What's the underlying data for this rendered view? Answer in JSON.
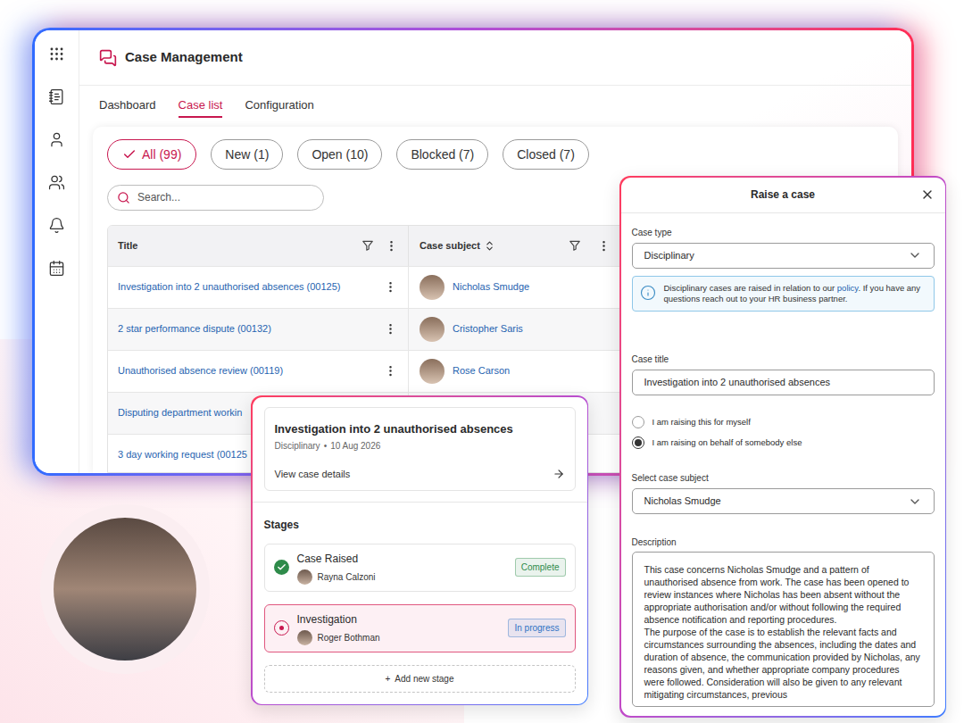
{
  "app": {
    "title": "Case Management"
  },
  "nav_tabs": [
    {
      "label": "Dashboard",
      "selected": false
    },
    {
      "label": "Case list",
      "selected": true
    },
    {
      "label": "Configuration",
      "selected": false
    }
  ],
  "filters": [
    {
      "label": "All (99)",
      "selected": true
    },
    {
      "label": "New (1)",
      "selected": false
    },
    {
      "label": "Open (10)",
      "selected": false
    },
    {
      "label": "Blocked (7)",
      "selected": false
    },
    {
      "label": "Closed (7)",
      "selected": false
    }
  ],
  "search": {
    "placeholder": "Search..."
  },
  "table": {
    "columns": [
      "Title",
      "Case subject"
    ],
    "rows": [
      {
        "title": "Investigation into 2 unauthorised absences (00125)",
        "subject": "Nicholas Smudge"
      },
      {
        "title": "2 star performance dispute (00132)",
        "subject": "Cristopher Saris"
      },
      {
        "title": "Unauthorised absence review (00119)",
        "subject": "Rose Carson"
      },
      {
        "title": "Disputing department workin"
      },
      {
        "title": "3 day working request (00125"
      }
    ]
  },
  "case_card": {
    "title": "Investigation into 2 unauthorised absences",
    "type": "Disciplinary",
    "separator": "•",
    "date": "10 Aug 2026",
    "link": "View case details",
    "stages_label": "Stages",
    "stages": [
      {
        "name": "Case Raised",
        "person": "Rayna Calzoni",
        "status": "Complete",
        "kind": "complete",
        "selected": false,
        "color": "#2e8b4a"
      },
      {
        "name": "Investigation",
        "person": "Roger Bothman",
        "status": "In progress",
        "kind": "active",
        "selected": true,
        "color": "#2f73c4"
      }
    ],
    "add_stage": {
      "icon": "+",
      "label": "Add new stage"
    }
  },
  "raise_case": {
    "title": "Raise a case",
    "case_type": {
      "label": "Case type",
      "value": "Disciplinary"
    },
    "info": {
      "before": "Disciplinary cases are raised in relation to our ",
      "link": "policy",
      "after": ". If you have any questions reach out to your HR business partner."
    },
    "case_title": {
      "label": "Case title",
      "value": "Investigation into 2 unauthorised absences"
    },
    "raising_options": [
      {
        "label": "I am raising this for myself",
        "selected": false
      },
      {
        "label": "I am raising on behalf of somebody else",
        "selected": true
      }
    ],
    "case_subject": {
      "label": "Select case subject",
      "value": "Nicholas Smudge"
    },
    "description": {
      "label": "Description",
      "paragraphs": [
        "This case concerns Nicholas Smudge and a pattern of unauthorised absence from work. The case has been opened to review instances where Nicholas has been absent without the appropriate authorisation and/or without following the required absence notification and reporting procedures.",
        "The purpose of the case is to establish the relevant facts and circumstances surrounding the absences, including the dates and duration of absence, the communication provided by Nicholas, any reasons given, and whether appropriate company procedures were followed. Consideration will also be given to any relevant mitigating circumstances, previous"
      ]
    }
  }
}
